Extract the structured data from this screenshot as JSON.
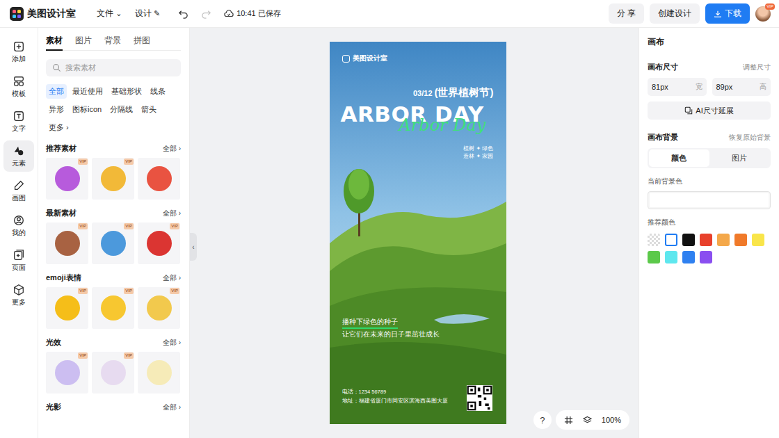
{
  "app": {
    "name": "美图设计室"
  },
  "menus": [
    {
      "label": "文件",
      "mark": "⌄"
    },
    {
      "label": "设计",
      "mark": "✎"
    }
  ],
  "history": {
    "undo_disabled": false,
    "redo_disabled": true
  },
  "save_status": "10:41 已保存",
  "header_buttons": [
    "分 享",
    "创建设计"
  ],
  "download": "下载",
  "avatar_badge": "VIP",
  "rail": [
    {
      "label": "添加",
      "selected": false
    },
    {
      "label": "模板",
      "selected": false
    },
    {
      "label": "文字",
      "selected": false
    },
    {
      "label": "元素",
      "selected": true
    },
    {
      "label": "画图",
      "selected": false
    },
    {
      "label": "我的",
      "selected": false
    },
    {
      "label": "页面",
      "selected": false
    },
    {
      "label": "更多",
      "selected": false
    }
  ],
  "panel_tabs": [
    {
      "label": "素材",
      "selected": true
    },
    {
      "label": "图片",
      "selected": false
    },
    {
      "label": "背景",
      "selected": false
    },
    {
      "label": "拼图",
      "selected": false
    }
  ],
  "search": {
    "placeholder": "搜索素材"
  },
  "chips": [
    {
      "label": "全部",
      "selected": true
    },
    {
      "label": "最近使用",
      "selected": false
    },
    {
      "label": "基础形状",
      "selected": false
    },
    {
      "label": "线条",
      "selected": false
    },
    {
      "label": "异形",
      "selected": false
    },
    {
      "label": "图标icon",
      "selected": false
    },
    {
      "label": "分隔线",
      "selected": false
    },
    {
      "label": "箭头",
      "selected": false
    },
    {
      "label": "更多 ›",
      "selected": false
    }
  ],
  "vip_label": "VIP",
  "sections": [
    {
      "title": "推荐素材",
      "more": "全部 ›",
      "items": [
        {
          "vip": true,
          "color": "#b04ad8"
        },
        {
          "vip": true,
          "color": "#f2b322"
        },
        {
          "vip": false,
          "color": "#e8412c"
        }
      ]
    },
    {
      "title": "最新素材",
      "more": "全部 ›",
      "items": [
        {
          "vip": true,
          "color": "#a0522d"
        },
        {
          "vip": true,
          "color": "#3a8fd8"
        },
        {
          "vip": true,
          "color": "#d8201c"
        }
      ]
    },
    {
      "title": "emoji表情",
      "more": "全部 ›",
      "items": [
        {
          "vip": true,
          "color": "#f5b800"
        },
        {
          "vip": true,
          "color": "#f7c21a"
        },
        {
          "vip": true,
          "color": "#f2c43a"
        }
      ]
    },
    {
      "title": "光效",
      "more": "全部 ›",
      "items": [
        {
          "vip": true,
          "color": "#c8b8f0"
        },
        {
          "vip": true,
          "color": "#e6d8ee"
        },
        {
          "vip": false,
          "color": "#f6eab0"
        }
      ]
    },
    {
      "title": "光影",
      "more": "全部 ›",
      "items": []
    }
  ],
  "poster": {
    "brand": "美图设计室",
    "date": "03/12",
    "festival": "(世界植树节)",
    "title": "ARBOR DAY",
    "script": "Arbor Day",
    "tags": [
      "植树 ✦ 绿色",
      "造林 ✦ 家园"
    ],
    "slogan": "播种下绿色的种子",
    "subline": "让它们在未来的日子里茁壮成长",
    "phone": "电话：1234 56789",
    "address": "地址：福建省厦门市同安区滨海西美图大厦"
  },
  "help": "?",
  "zoom": "100%",
  "right": {
    "title": "画布",
    "size_label": "画布尺寸",
    "resize": "调整尺寸",
    "width": "81px",
    "width_unit": "宽",
    "height": "89px",
    "height_unit": "高",
    "ai_button": "AI尺寸延展",
    "bg_label": "画布背景",
    "restore": "恢复原始背景",
    "segments": [
      {
        "label": "颜色",
        "selected": true
      },
      {
        "label": "图片",
        "selected": false
      }
    ],
    "current_label": "当前背景色",
    "recommend_label": "推荐颜色",
    "swatches": [
      {
        "kind": "transparent",
        "color": "#ffffff",
        "selected": false
      },
      {
        "kind": "solid",
        "color": "#ffffff",
        "selected": true
      },
      {
        "kind": "solid",
        "color": "#111111",
        "selected": false
      },
      {
        "kind": "solid",
        "color": "#e8412c",
        "selected": false
      },
      {
        "kind": "solid",
        "color": "#f4a84a",
        "selected": false
      },
      {
        "kind": "solid",
        "color": "#f07a2a",
        "selected": false
      },
      {
        "kind": "solid",
        "color": "#f9e54a",
        "selected": false
      },
      {
        "kind": "solid",
        "color": "#5cc94a",
        "selected": false
      },
      {
        "kind": "solid",
        "color": "#5ee7ee",
        "selected": false
      },
      {
        "kind": "solid",
        "color": "#2f80f0",
        "selected": false
      },
      {
        "kind": "solid",
        "color": "#8a4ff0",
        "selected": false
      }
    ]
  }
}
